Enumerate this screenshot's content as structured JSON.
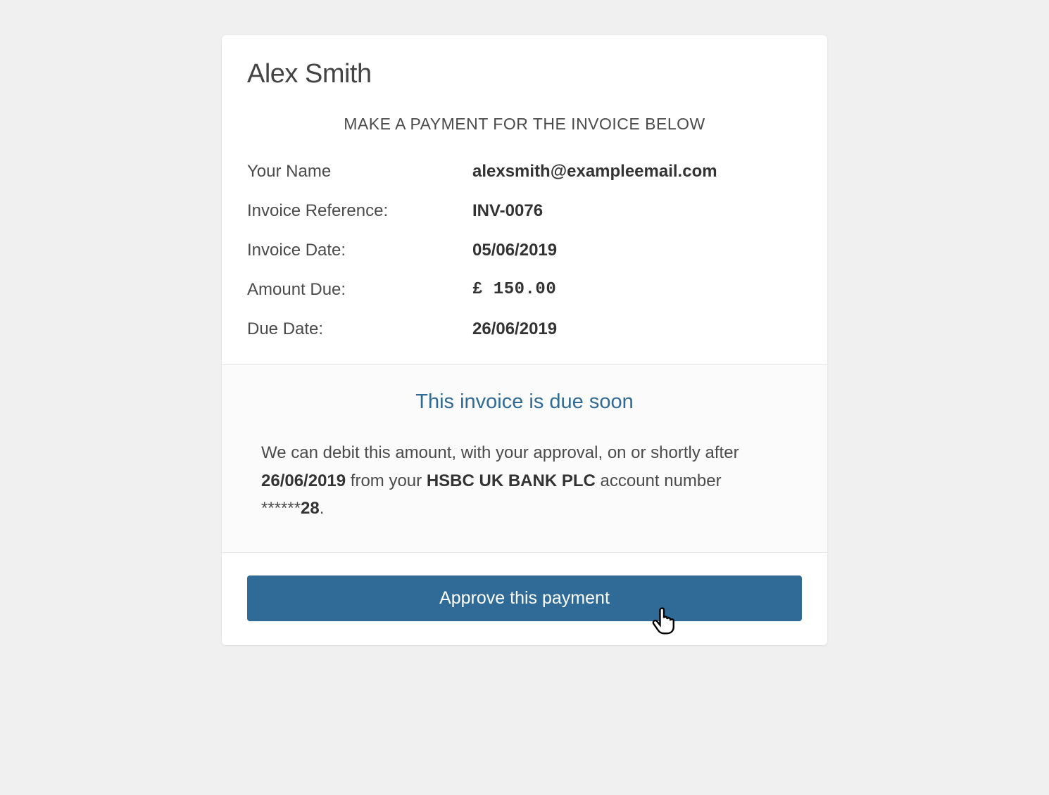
{
  "customer_name": "Alex Smith",
  "instruction": "MAKE A PAYMENT FOR THE INVOICE BELOW",
  "details": {
    "name_label": "Your Name",
    "name_value": "alexsmith@exampleemail.com",
    "invoice_ref_label": "Invoice Reference:",
    "invoice_ref_value": "INV-0076",
    "invoice_date_label": "Invoice Date:",
    "invoice_date_value": "05/06/2019",
    "amount_due_label": "Amount Due:",
    "amount_due_value": "£ 150.00",
    "due_date_label": "Due Date:",
    "due_date_value": "26/06/2019"
  },
  "status": {
    "title": "This invoice is due soon",
    "text_1": "We can debit this amount, with your approval, on or shortly after ",
    "debit_date": "26/06/2019",
    "text_2": " from your ",
    "bank_name": "HSBC UK BANK PLC",
    "text_3": " account number ",
    "account_mask": "******",
    "account_last": "28",
    "text_4": "."
  },
  "action": {
    "approve_label": "Approve this payment"
  }
}
